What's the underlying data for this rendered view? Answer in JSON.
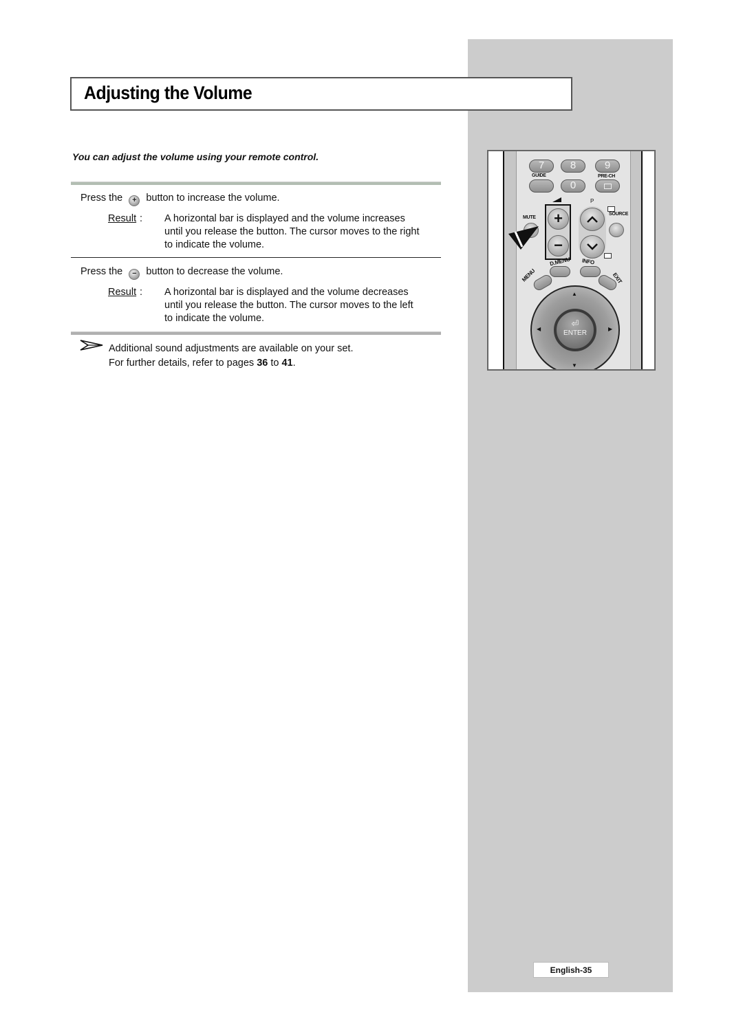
{
  "page": {
    "title": "Adjusting the Volume",
    "intro": "You can adjust the volume using your remote control.",
    "steps": [
      {
        "press_prefix": "Press the",
        "button_glyph": "+",
        "button_icon": "volume-up-button-icon",
        "press_suffix": "button to increase the volume.",
        "result_label": "Result",
        "result_lines": [
          "A horizontal bar is displayed and the volume increases",
          "until you release the button. The cursor moves to the right",
          "to indicate the volume."
        ]
      },
      {
        "press_prefix": "Press the",
        "button_glyph": "−",
        "button_icon": "volume-down-button-icon",
        "press_suffix": "button to decrease the volume.",
        "result_label": "Result",
        "result_lines": [
          "A horizontal bar is displayed and the volume decreases",
          "until you release the button. The cursor moves to the left",
          "to indicate the volume."
        ]
      }
    ],
    "note": {
      "icon": "arrow-pointer-icon",
      "line1": "Additional sound adjustments are available on your set.",
      "line2_prefix": "For further details, refer to pages",
      "page_from": "36",
      "line2_mid": "to",
      "page_to": "41",
      "line2_suffix": "."
    },
    "page_number": "English-35"
  },
  "remote": {
    "number_buttons": [
      "7",
      "8",
      "9",
      "",
      "0",
      ""
    ],
    "labels": {
      "guide": "GUIDE",
      "prech": "PRE-CH",
      "mute": "MUTE",
      "p": "P",
      "source": "SOURCE",
      "dmenu": "D.MENU",
      "info": "INFO",
      "menu": "MENU",
      "exit": "EXIT",
      "enter": "ENTER"
    },
    "glyphs": {
      "vol_up": "+",
      "vol_down": "−",
      "ch_up": "︿",
      "ch_down": "﹀",
      "up": "▲",
      "down": "▼",
      "left": "◀",
      "right": "▶",
      "enter_icon": "⏎"
    }
  }
}
